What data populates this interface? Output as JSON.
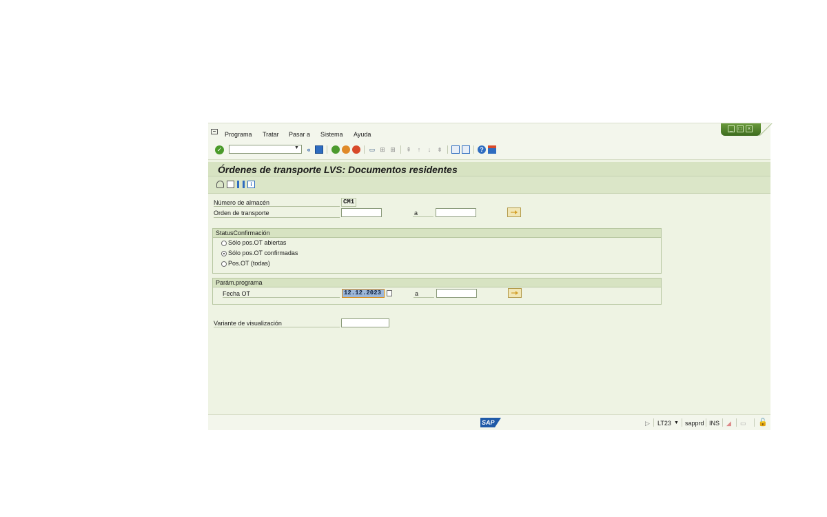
{
  "menu": {
    "items": [
      {
        "label": "Programa"
      },
      {
        "label": "Tratar"
      },
      {
        "label": "Pasar a"
      },
      {
        "label": "Sistema"
      },
      {
        "label": "Ayuda"
      }
    ]
  },
  "toolbar": {
    "command_value": "",
    "back_label": "«"
  },
  "screen": {
    "title": "Órdenes de transporte LVS: Documentos residentes"
  },
  "selection": {
    "warehouse_label": "Número de almacén",
    "warehouse_value": "CM1",
    "transport_order_label": "Orden de transporte",
    "transport_order_from": "",
    "to_label": "a",
    "transport_order_to": ""
  },
  "status_group": {
    "title": "StatusConfirmación",
    "options": [
      {
        "label": "Sólo pos.OT abiertas",
        "selected": false
      },
      {
        "label": "Sólo pos.OT confirmadas",
        "selected": true
      },
      {
        "label": "Pos.OT (todas)",
        "selected": false
      }
    ]
  },
  "params_group": {
    "title": "Parám.programa",
    "date_label": "Fecha OT",
    "date_from": "12.12.2023",
    "to_label": "a",
    "date_to": ""
  },
  "layout_variant": {
    "label": "Variante de visualización",
    "value": ""
  },
  "statusbar": {
    "logo_text": "SAP",
    "transaction": "LT23",
    "server": "sapprd",
    "mode": "INS"
  },
  "colors": {
    "accent": "#d7e3c2",
    "background": "#eef3e3",
    "sap_blue": "#1f5aa8"
  }
}
